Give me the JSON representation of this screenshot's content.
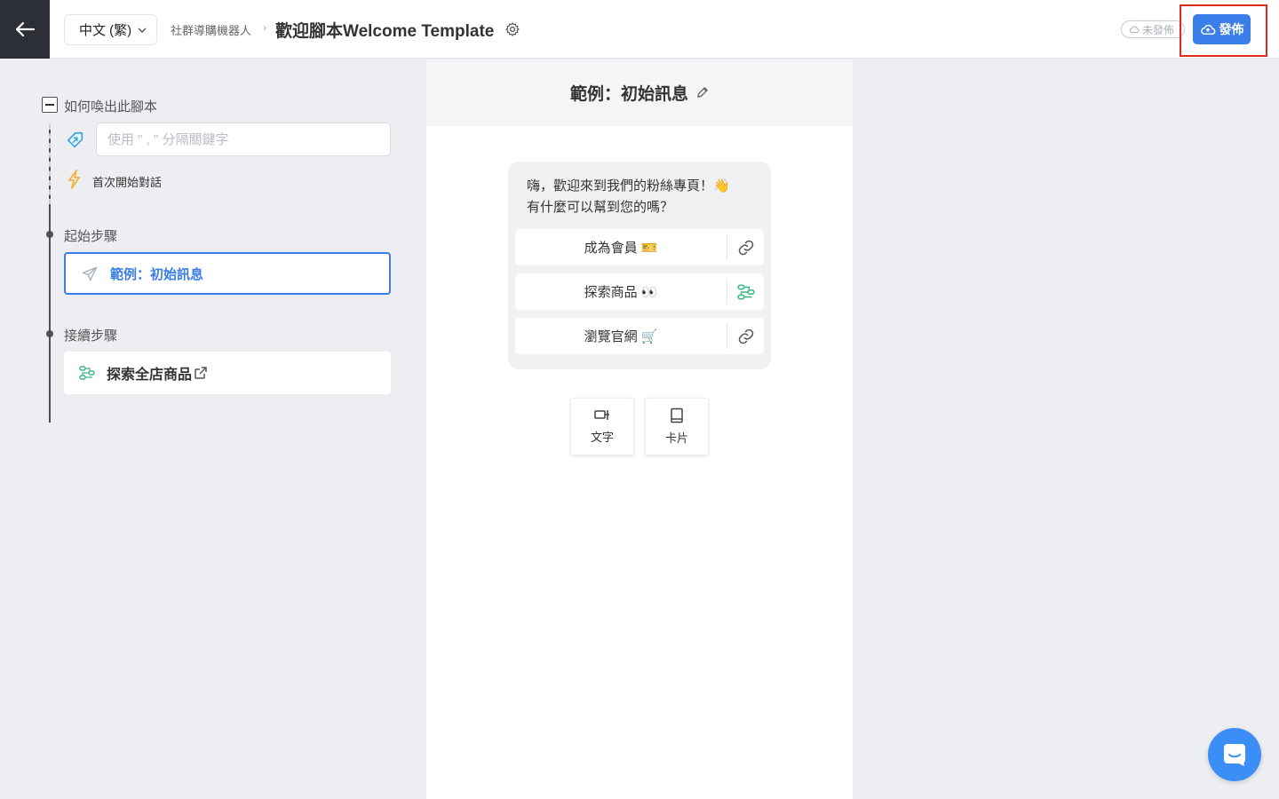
{
  "header": {
    "language": "中文 (繁)",
    "breadcrumb_parent": "社群導購機器人",
    "breadcrumb_separator": "›",
    "title": "歡迎腳本Welcome Template",
    "status": "未發佈",
    "publish_label": "發佈"
  },
  "sidebar": {
    "trigger_section_label": "如何喚出此腳本",
    "keyword_placeholder": "使用 \" , \" 分隔關鍵字",
    "keyword_value": "",
    "first_conversation_label": "首次開始對話",
    "start_step_label": "起始步驟",
    "start_step_item": "範例：初始訊息",
    "next_step_label": "接續步驟",
    "next_step_item": "探索全店商品"
  },
  "editor": {
    "title": "範例：初始訊息",
    "message": "嗨，歡迎來到我們的粉絲專頁！👋\n有什麼可以幫到您的嗎？",
    "buttons": [
      {
        "label": "成為會員 🎫",
        "action_icon": "link-icon"
      },
      {
        "label": "探索商品 👀",
        "action_icon": "flow-icon"
      },
      {
        "label": "瀏覽官網 🛒",
        "action_icon": "link-icon"
      }
    ],
    "add_text_label": "文字",
    "add_card_label": "卡片"
  },
  "colors": {
    "accent": "#3b7de9",
    "highlight": "#e0281c",
    "flow_green": "#3dbb87",
    "chat_launcher": "#3a8ef6"
  }
}
